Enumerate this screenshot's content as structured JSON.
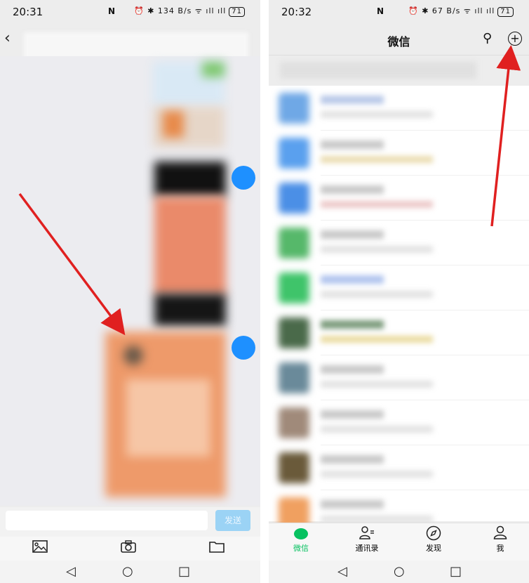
{
  "left_screen": {
    "status": {
      "time": "20:31",
      "net_speed": "134 B/s",
      "battery": "71"
    },
    "chat": {
      "send_label": "发送"
    },
    "toolbar": {
      "image_icon": "image-icon",
      "camera_icon": "camera-icon",
      "folder_icon": "folder-icon"
    }
  },
  "right_screen": {
    "status": {
      "time": "20:32",
      "net_speed": "67 B/s",
      "battery": "71"
    },
    "header": {
      "title": "微信"
    },
    "tabs": [
      {
        "label": "微信",
        "icon": "chat-icon",
        "active": true
      },
      {
        "label": "通讯录",
        "icon": "contacts-icon",
        "active": false
      },
      {
        "label": "发现",
        "icon": "compass-icon",
        "active": false
      },
      {
        "label": "我",
        "icon": "profile-icon",
        "active": false
      }
    ],
    "accent_color": "#07c160"
  },
  "annotation": {
    "arrow_color": "#e02020"
  }
}
